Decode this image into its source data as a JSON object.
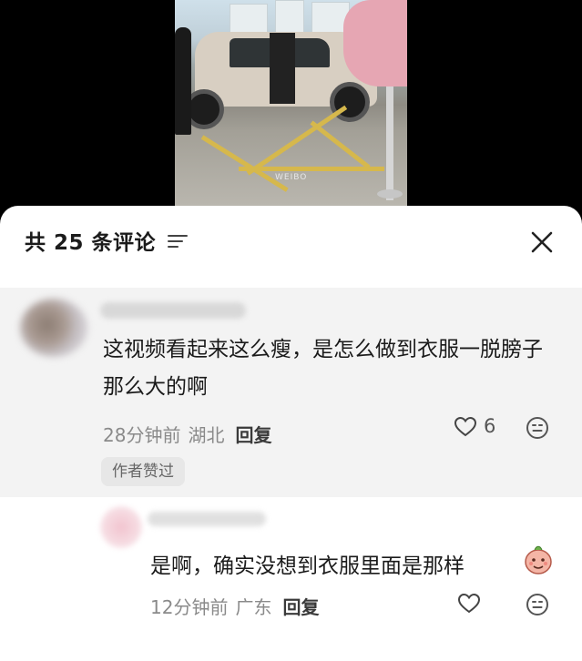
{
  "video": {
    "watermark": "WEIBO"
  },
  "header": {
    "title": "共 25 条评论"
  },
  "comments": [
    {
      "text": "这视频看起来这么瘦，是怎么做到衣服一脱膀子那么大的啊",
      "time": "28分钟前",
      "location": "湖北",
      "reply_label": "回复",
      "likes": "6",
      "badge": "作者赞过"
    },
    {
      "text": "是啊，确实没想到衣服里面是那样",
      "time": "12分钟前",
      "location": "广东",
      "reply_label": "回复"
    }
  ],
  "icons": {
    "filter": "filter-icon",
    "close": "close-icon",
    "like": "heart-icon",
    "emoji": "emoji-icon",
    "sticker": "sticker-icon"
  },
  "colors": {
    "sheet_bg": "#ffffff",
    "highlight_bg": "#f3f3f3",
    "badge_bg": "#e7e7e7",
    "meta_text": "#8a8a8a",
    "primary_text": "#1b1b1b"
  }
}
